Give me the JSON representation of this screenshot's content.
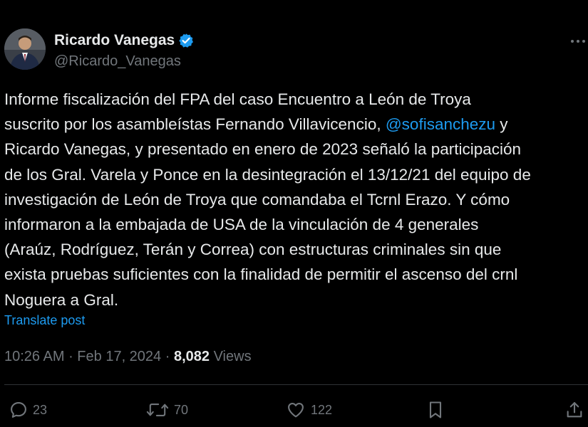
{
  "author": {
    "display_name": "Ricardo Vanegas",
    "handle": "@Ricardo_Vanegas",
    "verified": true
  },
  "tweet": {
    "lines": [
      [
        "Informe fiscalización del FPA del caso Encuentro a León de Troya"
      ],
      [
        "suscrito por los asambleístas Fernando Villavicencio, ",
        "@sofisanchezu",
        " y"
      ],
      [
        "Ricardo Vanegas, y presentado en enero de 2023 señaló la participación"
      ],
      [
        "de los Gral. Varela y Ponce en la desintegración el 13/12/21 del equipo de"
      ],
      [
        "investigación de León de Troya que comandaba el Tcrnl Erazo. Y cómo"
      ],
      [
        "informaron a la embajada de USA de la vinculación de 4 generales"
      ],
      [
        "(Araúz, Rodríguez, Terán y Correa) con estructuras criminales sin que"
      ],
      [
        "exista pruebas suficientes con la finalidad de permitir el ascenso del crnl"
      ],
      [
        "Noguera a Gral."
      ]
    ],
    "mention": "@sofisanchezu",
    "translate_label": "Translate post"
  },
  "meta": {
    "time": "10:26 AM",
    "separator": " · ",
    "date": "Feb 17, 2024",
    "views_count": "8,082",
    "views_label": "Views"
  },
  "actions": {
    "replies": "23",
    "reposts": "70",
    "likes": "122"
  },
  "icons": {
    "verified": "verified-badge-icon",
    "more": "more-horizontal-icon",
    "reply": "reply-icon",
    "repost": "repost-icon",
    "like": "heart-icon",
    "bookmark": "bookmark-icon",
    "share": "share-icon"
  },
  "colors": {
    "background": "#000000",
    "text": "#e7e9ea",
    "secondary": "#71767b",
    "accent": "#1d9bf0",
    "divider": "#2f3336"
  }
}
